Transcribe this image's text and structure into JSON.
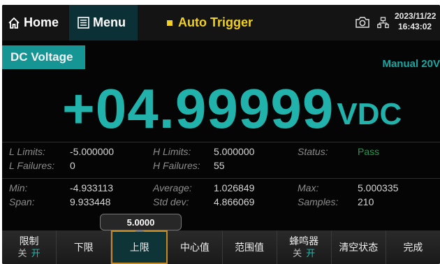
{
  "topbar": {
    "home_label": "Home",
    "menu_label": "Menu",
    "trigger_label": "Auto Trigger",
    "date": "2023/11/22",
    "time": "16:43:02"
  },
  "function_label": "DC Voltage",
  "range_label": "Manual 20V",
  "reading": {
    "value": "+04.99999",
    "unit": "VDC"
  },
  "stats": {
    "row1": {
      "l_limits_label": "L Limits:",
      "l_limits_value": "-5.000000",
      "l_failures_label": "L Failures:",
      "l_failures_value": "0",
      "h_limits_label": "H Limits:",
      "h_limits_value": "5.000000",
      "h_failures_label": "H Failures:",
      "h_failures_value": "55",
      "status_label": "Status:",
      "status_value": "Pass"
    },
    "row2": {
      "min_label": "Min:",
      "min_value": "-4.933113",
      "span_label": "Span:",
      "span_value": "9.933448",
      "average_label": "Average:",
      "average_value": "1.026849",
      "stddev_label": "Std dev:",
      "stddev_value": "4.866069",
      "max_label": "Max:",
      "max_value": "5.000335",
      "samples_label": "Samples:",
      "samples_value": "210"
    }
  },
  "tooltip_value": "5.0000",
  "softkeys": [
    {
      "label": "限制",
      "off": "关",
      "on": "开"
    },
    {
      "label": "下限"
    },
    {
      "label": "上限"
    },
    {
      "label": "中心值"
    },
    {
      "label": "范围值"
    },
    {
      "label": "蜂鸣器",
      "off": "关",
      "on": "开"
    },
    {
      "label": "清空状态"
    },
    {
      "label": "完成"
    }
  ],
  "colors": {
    "accent": "#20b2ab",
    "trigger": "#f0d020",
    "pass": "#17a04a",
    "active_border": "#c58a25"
  }
}
